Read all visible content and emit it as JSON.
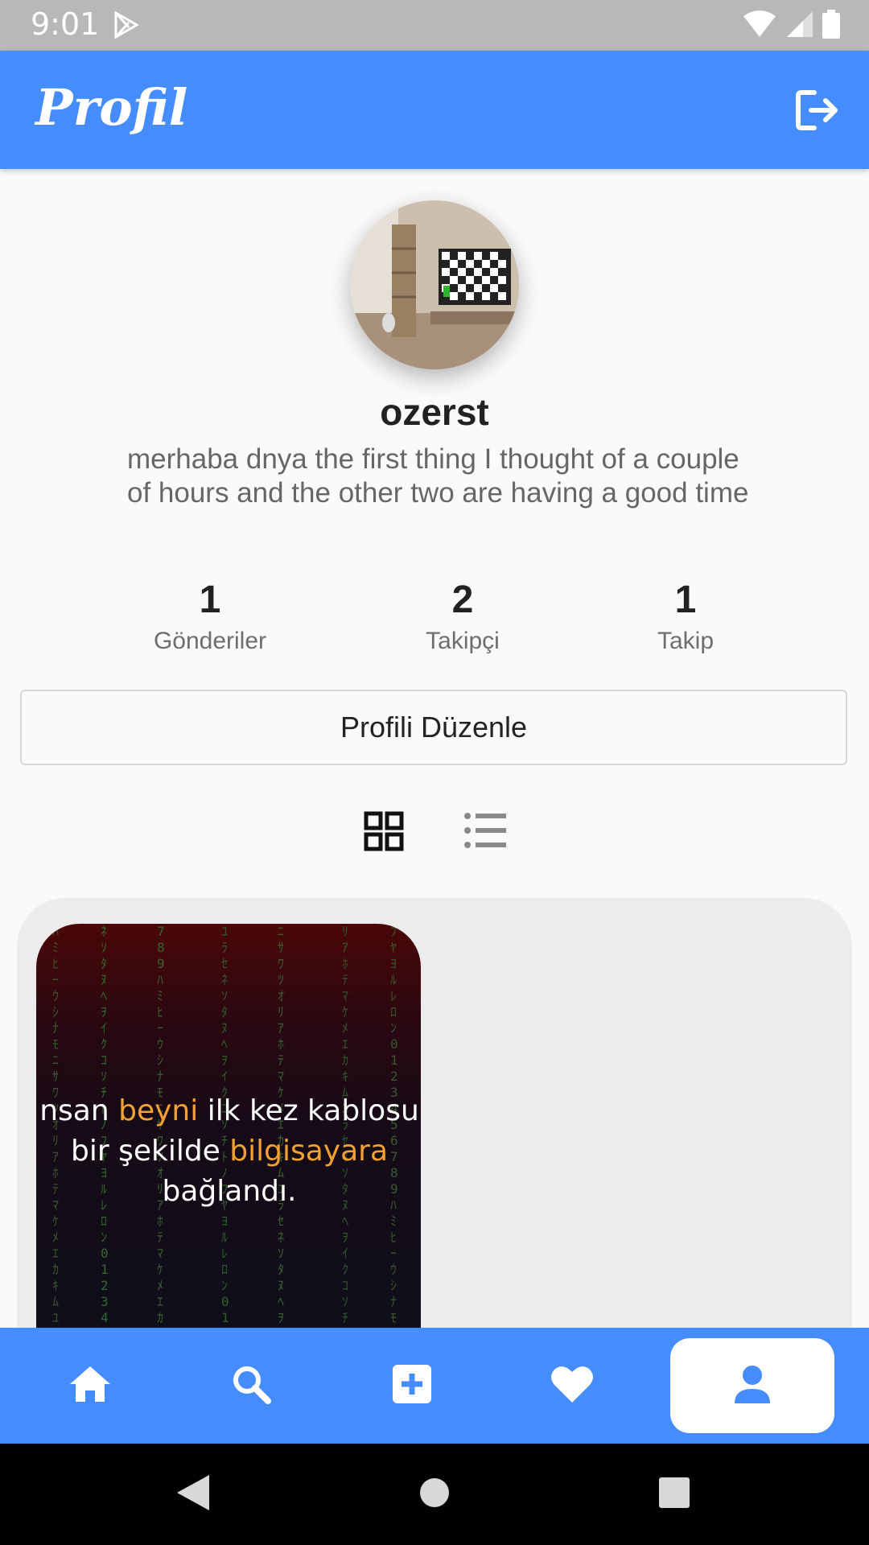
{
  "status_bar": {
    "time": "9:01",
    "icons": [
      "play-store-icon",
      "wifi-icon",
      "signal-icon",
      "battery-icon"
    ]
  },
  "app_bar": {
    "title": "Profil",
    "action_icon": "logout-icon",
    "color": "#458cff"
  },
  "profile": {
    "avatar_icon": "avatar-room-image",
    "username": "ozerst",
    "bio": "merhaba dnya the first thing I thought of a couple of hours and the other two are having a good time",
    "stats": [
      {
        "value": "1",
        "label": "Gönderiler"
      },
      {
        "value": "2",
        "label": "Takipçi"
      },
      {
        "value": "1",
        "label": "Takip"
      }
    ],
    "edit_button": "Profili Düzenle"
  },
  "view_toggle": {
    "options": [
      "grid-view-icon",
      "list-view-icon"
    ],
    "selected": "grid-view-icon"
  },
  "posts": [
    {
      "text_parts": [
        {
          "text": "nsan ",
          "highlight": false
        },
        {
          "text": "beyni",
          "highlight": true
        },
        {
          "text": " ilk kez kablosu",
          "highlight": false
        },
        {
          "text": "bir şekilde ",
          "highlight": false
        },
        {
          "text": "bilgisayara",
          "highlight": true
        },
        {
          "text": "bağlandı.",
          "highlight": false
        }
      ],
      "highlight_color": "#f3a132"
    }
  ],
  "bottom_nav": {
    "items": [
      "home-icon",
      "search-icon",
      "add-post-icon",
      "favorites-icon",
      "profile-icon"
    ],
    "active": "profile-icon"
  },
  "system_nav": [
    "back-icon",
    "home-circle-icon",
    "recents-icon"
  ]
}
